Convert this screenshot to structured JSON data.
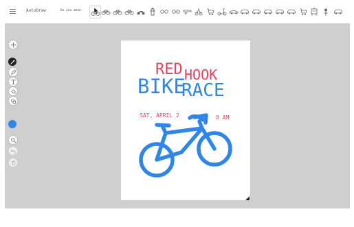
{
  "app": {
    "title": "AutoDraw"
  },
  "toolbar": {
    "menu_icon": "hamburger-menu-icon",
    "suggestions_label": "Do you mean:",
    "suggestions": [
      "bicycle-icon",
      "bicycle-icon",
      "bicycle-icon",
      "bicycle-icon",
      "motorbike-icon",
      "hydrant-icon",
      "glasses-icon",
      "glasses-icon",
      "gun-icon",
      "tricycle-icon",
      "cart-icon",
      "scooter-icon",
      "sports-car-icon",
      "car-icon",
      "car-icon",
      "car-icon",
      "car-icon",
      "car-icon",
      "cart-icon",
      "robot-icon",
      "flower-icon",
      "car-icon"
    ]
  },
  "tools": [
    {
      "name": "move-tool",
      "icon": "move-arrows-icon"
    },
    {
      "name": "autodraw-tool",
      "icon": "autodraw-wand-icon",
      "active": true
    },
    {
      "name": "draw-tool",
      "icon": "pencil-icon"
    },
    {
      "name": "type-tool",
      "icon": "type-icon"
    },
    {
      "name": "fill-tool",
      "icon": "fill-bucket-icon"
    },
    {
      "name": "shape-tool",
      "icon": "shape-icon"
    },
    {
      "name": "color-tool",
      "icon": "color-swatch-icon",
      "color": "#2f86e8"
    },
    {
      "name": "zoom-tool",
      "icon": "zoom-icon"
    },
    {
      "name": "undo-tool",
      "icon": "undo-icon"
    },
    {
      "name": "delete-tool",
      "icon": "trash-icon"
    }
  ],
  "poster": {
    "line1a": "RED",
    "line1b": "HOOK",
    "line2a": "BIKE",
    "line2b": "RACE",
    "date": "SAT, APRIL 2",
    "time": "8 AM",
    "colors": {
      "red": "#e8415a",
      "blue": "#2f86e8"
    }
  }
}
